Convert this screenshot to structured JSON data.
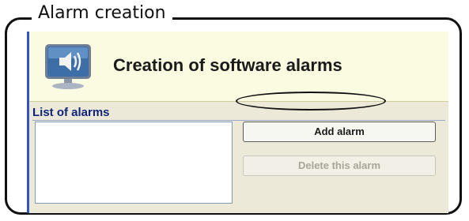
{
  "frame": {
    "title": "Alarm creation"
  },
  "header": {
    "title": "Creation of software alarms",
    "icon": "speaker-monitor-icon"
  },
  "list": {
    "label": "List of alarms",
    "items": []
  },
  "buttons": {
    "add_label": "Add alarm",
    "delete_label": "Delete this alarm",
    "delete_enabled": false
  },
  "colors": {
    "accent": "#3355bb",
    "header_bg": "#fbfbe2",
    "panel_bg": "#ece9d8",
    "label": "#10247a"
  }
}
